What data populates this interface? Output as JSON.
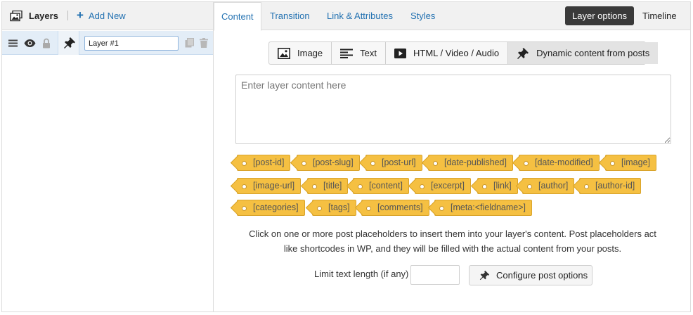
{
  "layers_panel": {
    "title": "Layers",
    "add_new_label": "Add New",
    "layer": {
      "name_value": "Layer #1"
    }
  },
  "tabs": [
    {
      "label": "Content",
      "active": true
    },
    {
      "label": "Transition",
      "active": false
    },
    {
      "label": "Link & Attributes",
      "active": false
    },
    {
      "label": "Styles",
      "active": false
    }
  ],
  "header_buttons": {
    "layer_options": "Layer options",
    "timeline": "Timeline"
  },
  "layer_types": [
    {
      "label": "Image",
      "icon": "image-icon",
      "active": false
    },
    {
      "label": "Text",
      "icon": "text-icon",
      "active": false
    },
    {
      "label": "HTML / Video / Audio",
      "icon": "video-icon",
      "active": false
    },
    {
      "label": "Dynamic content from posts",
      "icon": "pin-icon",
      "active": true
    }
  ],
  "content": {
    "placeholder": "Enter layer content here",
    "value": ""
  },
  "placeholders": [
    [
      "[post-id]",
      "[post-slug]",
      "[post-url]",
      "[date-published]",
      "[date-modified]",
      "[image]"
    ],
    [
      "[image-url]",
      "[title]",
      "[content]",
      "[excerpt]",
      "[link]",
      "[author]",
      "[author-id]"
    ],
    [
      "[categories]",
      "[tags]",
      "[comments]",
      "[meta:<fieldname>]"
    ]
  ],
  "help_text": "Click on one or more post placeholders to insert them into your layer's content. Post placeholders act like shortcodes in WP, and they will be filled with the actual content from your posts.",
  "limit": {
    "label": "Limit text length (if any)",
    "value": ""
  },
  "configure_button": "Configure post options",
  "colors": {
    "link": "#2271b1",
    "tag_fill": "#f5c042",
    "tag_border": "#d9a42c",
    "dark_button": "#3a3a3a",
    "selected_row": "#e3edf7"
  }
}
